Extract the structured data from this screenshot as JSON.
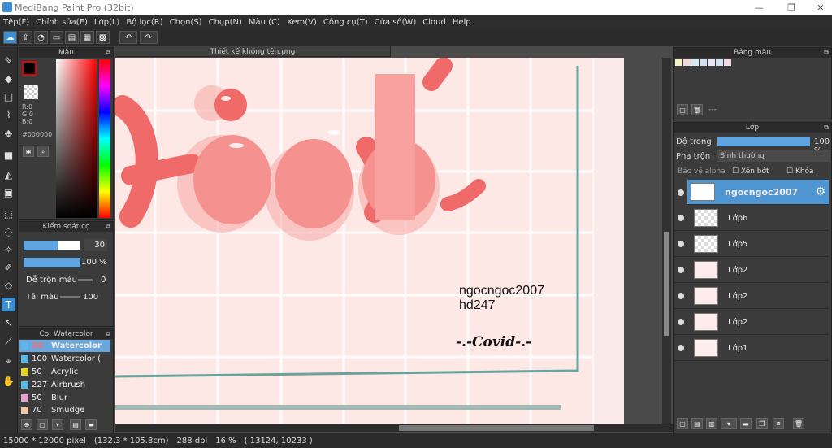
{
  "window": {
    "title": "MediBang Paint Pro (32bit)"
  },
  "menu": [
    "Tệp(F)",
    "Chỉnh sửa(E)",
    "Lớp(L)",
    "Bộ lọc(R)",
    "Chọn(S)",
    "Chụp(N)",
    "Màu (C)",
    "Xem(V)",
    "Công cụ(T)",
    "Cửa sổ(W)",
    "Cloud",
    "Help"
  ],
  "toolbar": {
    "undo_icon": "undo-arrow-icon",
    "redo_icon": "redo-arrow-icon"
  },
  "color_panel": {
    "title": "Màu",
    "r": "R:0",
    "g": "G:0",
    "b": "B:0",
    "hex": "#000000"
  },
  "brush_control": {
    "title": "Kiểm soát cọ",
    "size": "30",
    "opacity": "100 %",
    "blend_label": "Dễ trộn màu",
    "blend_value": "0",
    "reload_label": "Tải màu",
    "reload_value": "100"
  },
  "brush_list": {
    "title": "Cọ: Watercolor",
    "items": [
      {
        "size": "30",
        "name": "Watercolor",
        "color": "#5bb7e8"
      },
      {
        "size": "100",
        "name": "Watercolor (",
        "color": "#5bb7e8"
      },
      {
        "size": "50",
        "name": "Acrylic",
        "color": "#e6d32a"
      },
      {
        "size": "227",
        "name": "Airbrush",
        "color": "#5bb7e8"
      },
      {
        "size": "50",
        "name": "Blur",
        "color": "#e7a0ce"
      },
      {
        "size": "70",
        "name": "Smudge",
        "color": "#f0c8a8"
      }
    ]
  },
  "document": {
    "tab_title": "Thiết kế không tên.png",
    "text_line1": "ngocngoc2007",
    "text_line2": "hd247",
    "signature": "-.-Covid-.-"
  },
  "palette_panel": {
    "title": "Bảng màu",
    "palette_name": "---",
    "swatches": [
      "#f3f3c8",
      "#f2d8d8",
      "#d8e9f6",
      "#cfe1f3",
      "#e7e7f3",
      "#d2e4f3",
      "#f3d8e6"
    ]
  },
  "layer_panel": {
    "title": "Lớp",
    "opacity_label": "Độ trong",
    "opacity_value": "100 %",
    "blend_label": "Pha trộn",
    "blend_value": "Bình thường",
    "alpha_protect": "Bảo vệ alpha",
    "clipping": "Xén bớt",
    "lock": "Khóa",
    "layers": [
      {
        "name": "ngocngoc2007",
        "selected": true
      },
      {
        "name": "Lớp6",
        "selected": false
      },
      {
        "name": "Lớp5",
        "selected": false
      },
      {
        "name": "Lớp2",
        "selected": false
      },
      {
        "name": "Lớp2",
        "selected": false
      },
      {
        "name": "Lớp2",
        "selected": false
      },
      {
        "name": "Lớp1",
        "selected": false
      }
    ]
  },
  "status": {
    "canvas_size": "15000 * 12000 pixel",
    "phys_size": "(132.3 * 105.8cm)",
    "dpi": "288 dpi",
    "zoom": "16 %",
    "coords": "( 13124, 10233 )"
  },
  "colors": {
    "accent": "#3d8fd1",
    "selection": "#4f95d2",
    "canvas_bg": "#fde8e5",
    "letters": "#f06a6a"
  }
}
